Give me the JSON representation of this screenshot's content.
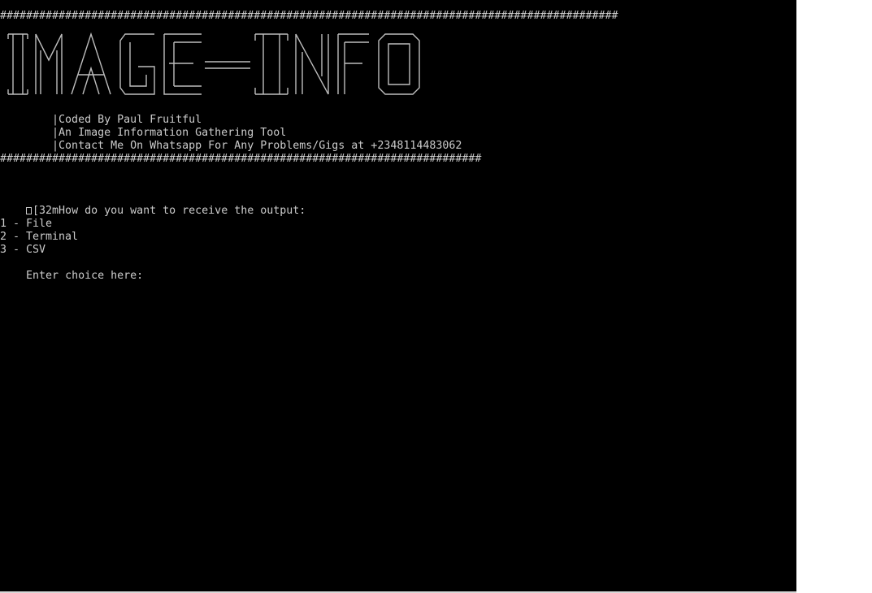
{
  "terminal": {
    "hash_rule_top": "###############################################################################################",
    "banner_text": "IMAGE-INFO",
    "info_lines": [
      "        |Coded By Paul Fruitful",
      "        |An Image Information Gathering Tool",
      "        |Contact Me On Whatsapp For Any Problems/Gigs at +2348114483062"
    ],
    "hash_rule_bottom": "##########################################################################",
    "escape_symbol": "replacement-box-icon",
    "prompt_question": "[32mHow do you want to receive the output:",
    "options": [
      "1 - File",
      "2 - Terminal",
      "3 - CSV"
    ],
    "input_prompt": "Enter choice here:",
    "input_value": ""
  },
  "colors": {
    "background": "#000000",
    "text": "#cccccc",
    "outside": "#ffffff"
  }
}
